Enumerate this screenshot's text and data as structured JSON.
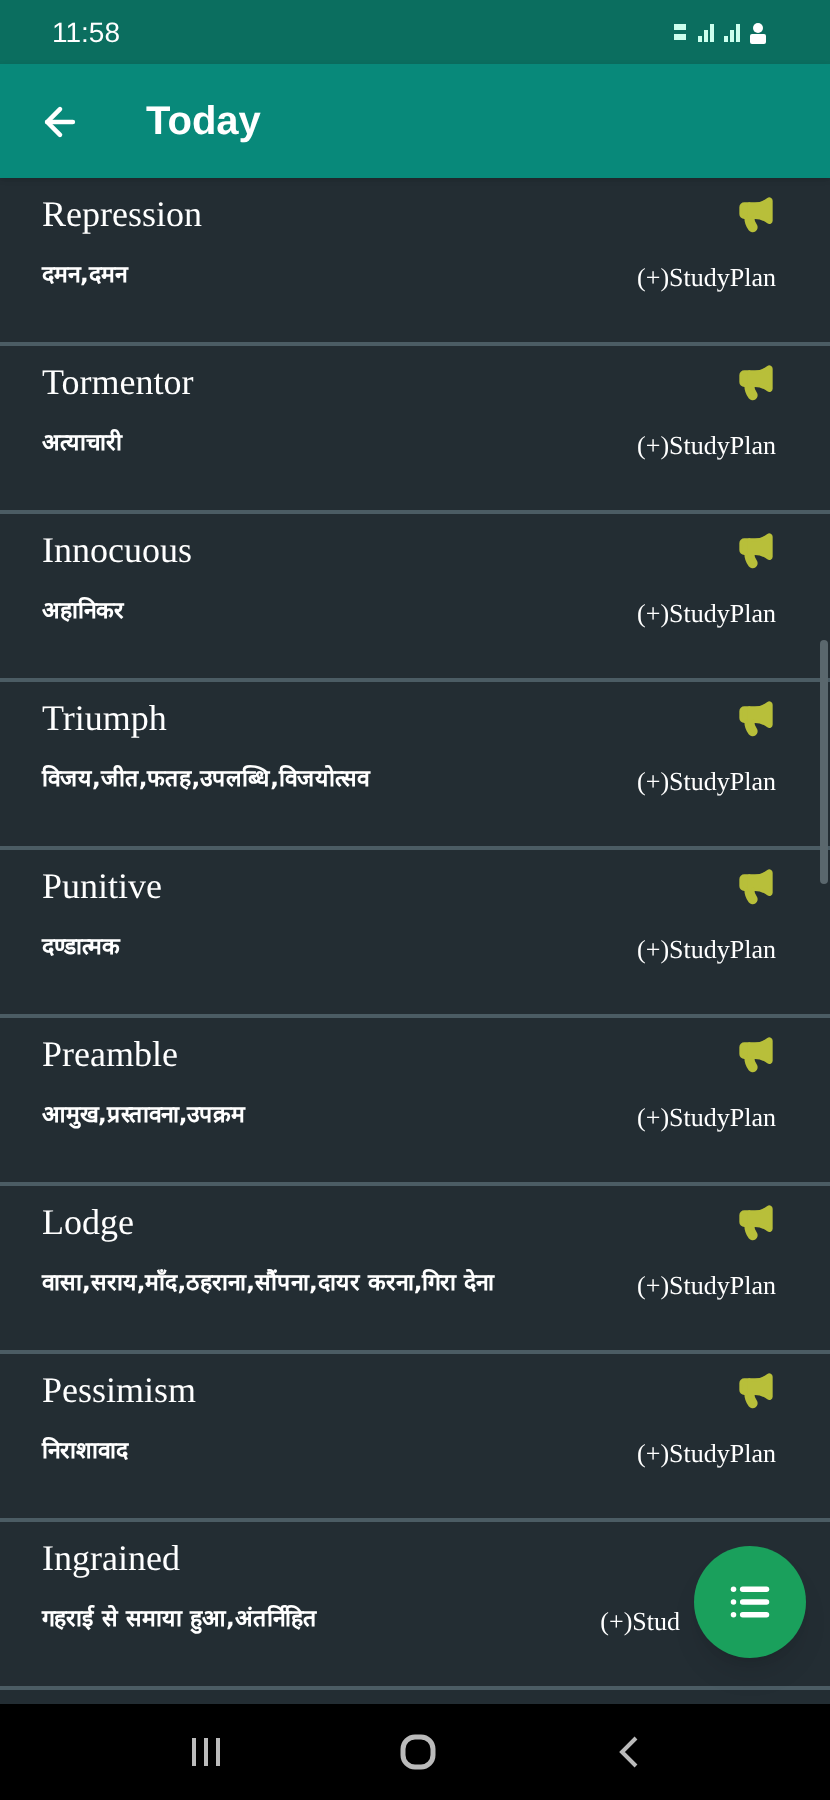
{
  "status_bar": {
    "time": "11:58"
  },
  "app_bar": {
    "title": "Today"
  },
  "words": [
    {
      "word": "Repression",
      "meaning": "दमन,दमन",
      "action": "(+)StudyPlan"
    },
    {
      "word": "Tormentor",
      "meaning": "अत्याचारी",
      "action": "(+)StudyPlan"
    },
    {
      "word": "Innocuous",
      "meaning": "अहानिकर",
      "action": "(+)StudyPlan"
    },
    {
      "word": "Triumph",
      "meaning": "विजय,जीत,फतह,उपलब्धि,विजयोत्सव",
      "action": "(+)StudyPlan"
    },
    {
      "word": "Punitive",
      "meaning": "दण्डात्मक",
      "action": "(+)StudyPlan"
    },
    {
      "word": "Preamble",
      "meaning": "आमुख,प्रस्तावना,उपक्रम",
      "action": "(+)StudyPlan"
    },
    {
      "word": "Lodge",
      "meaning": "वासा,सराय,माँद,ठहराना,सौंपना,दायर करना,गिरा देना",
      "action": "(+)StudyPlan"
    },
    {
      "word": "Pessimism",
      "meaning": "निराशावाद",
      "action": "(+)StudyPlan"
    },
    {
      "word": "Ingrained",
      "meaning": "गहराई से समाया हुआ,अंतर्निहित",
      "action": "(+)Stud",
      "speaker_shown": false
    }
  ]
}
